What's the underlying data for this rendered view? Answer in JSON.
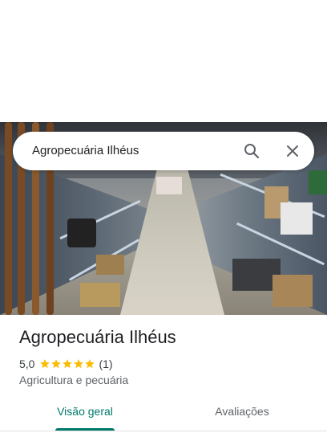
{
  "search": {
    "query": "Agropecuária Ilhéus",
    "search_icon": "search-icon",
    "close_icon": "close-icon"
  },
  "photo": {
    "description_icon": "store-photo"
  },
  "place": {
    "name": "Agropecuária Ilhéus",
    "rating": "5,0",
    "stars": 5,
    "review_count": "(1)",
    "category": "Agricultura e pecuária"
  },
  "tabs": [
    {
      "label": "Visão geral",
      "active": true
    },
    {
      "label": "Avaliações",
      "active": false
    }
  ],
  "colors": {
    "accent": "#00796b",
    "star": "#fbbc04",
    "text": "#202124",
    "secondary": "#5f6368"
  }
}
